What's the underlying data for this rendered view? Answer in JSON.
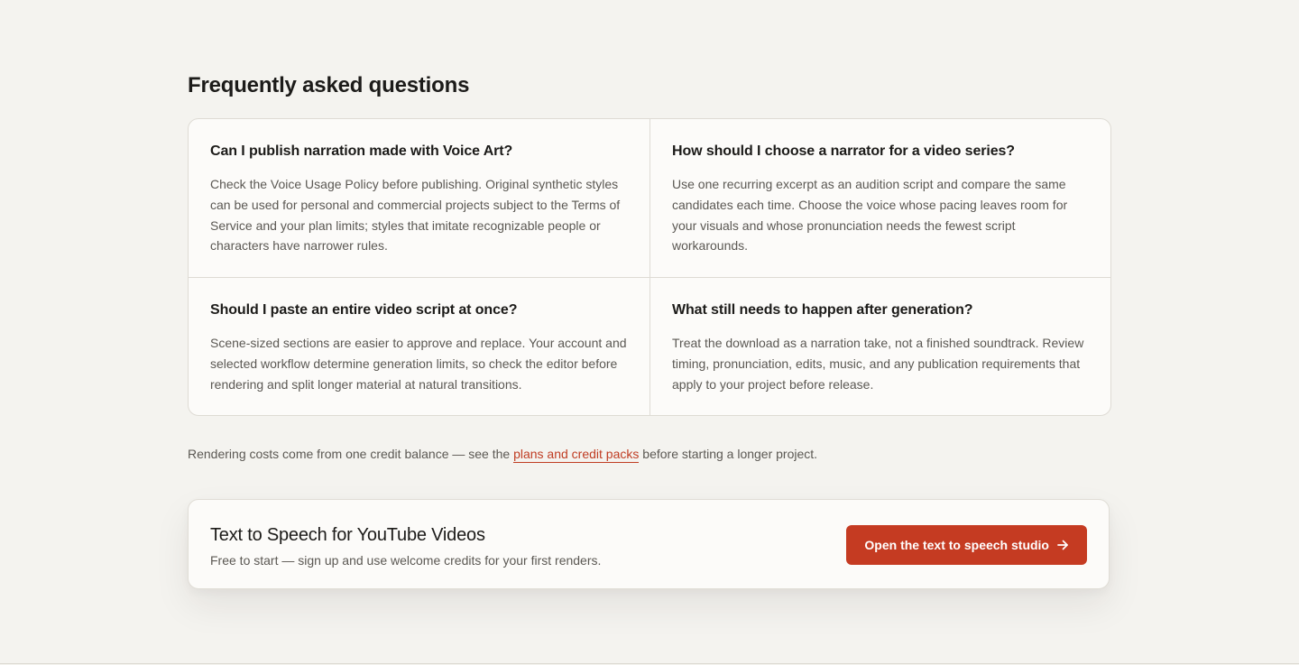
{
  "faq": {
    "title": "Frequently asked questions",
    "items": [
      {
        "question": "Can I publish narration made with Voice Art?",
        "answer": "Check the Voice Usage Policy before publishing. Original synthetic styles can be used for personal and commercial projects subject to the Terms of Service and your plan limits; styles that imitate recognizable people or characters have narrower rules."
      },
      {
        "question": "How should I choose a narrator for a video series?",
        "answer": "Use one recurring excerpt as an audition script and compare the same candidates each time. Choose the voice whose pacing leaves room for your visuals and whose pronunciation needs the fewest script workarounds."
      },
      {
        "question": "Should I paste an entire video script at once?",
        "answer": "Scene-sized sections are easier to approve and replace. Your account and selected workflow determine generation limits, so check the editor before rendering and split longer material at natural transitions."
      },
      {
        "question": "What still needs to happen after generation?",
        "answer": "Treat the download as a narration take, not a finished soundtrack. Review timing, pronunciation, edits, music, and any publication requirements that apply to your project before release."
      }
    ]
  },
  "note": {
    "before": "Rendering costs come from one credit balance — see the ",
    "link": "plans and credit packs",
    "after": " before starting a longer project."
  },
  "cta": {
    "title": "Text to Speech for YouTube Videos",
    "subtitle": "Free to start — sign up and use welcome credits for your first renders.",
    "button_label": "Open the text to speech studio",
    "button_icon": "arrow-right-icon"
  },
  "colors": {
    "background": "#f4f3ef",
    "card": "#fcfbf9",
    "accent": "#c53b22",
    "link": "#c03d23",
    "border": "#dedbd4"
  }
}
